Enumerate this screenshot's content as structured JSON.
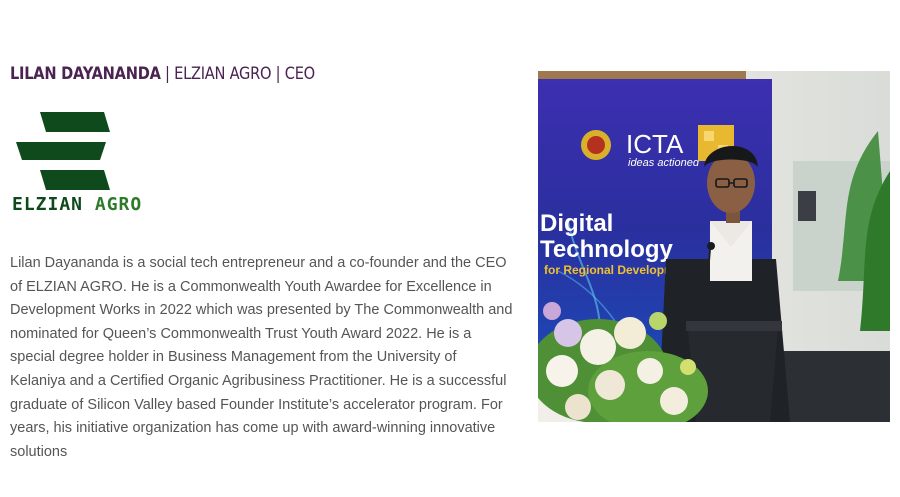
{
  "profile": {
    "name": "LILAN DAYANANDA",
    "separator": " | ",
    "company": "ELZIAN AGRO",
    "role": "CEO"
  },
  "logo": {
    "text_part1": "ELZIAN",
    "text_part2": "AGRO",
    "colors": {
      "dark_green": "#0f4a1c",
      "light_green": "#2f7a2a"
    }
  },
  "bio": "Lilan Dayananda is a social tech entrepreneur and a co-founder and the CEO of ELZIAN AGRO. He is a Commonwealth Youth Awardee for Excellence in Development Works in 2022 which was presented by The Commonwealth and nominated for Queen’s Commonwealth Trust Youth Award 2022. He is a special degree holder in Business Management from the University of Kelaniya and a Certified Organic Agribusiness Practitioner. He is a successful graduate of Silicon Valley based Founder Institute’s accelerator program. For years, his initiative organization has come up with award-winning innovative solutions",
  "photo": {
    "banner_brand": "ICTA",
    "banner_tagline": "ideas actioned",
    "banner_line1": "Digital",
    "banner_line2": "Technology",
    "banner_line3": "for Regional Developm"
  },
  "colors": {
    "heading": "#4b2352",
    "body_text": "#555555",
    "banner_blue": "#2a2f9e"
  }
}
